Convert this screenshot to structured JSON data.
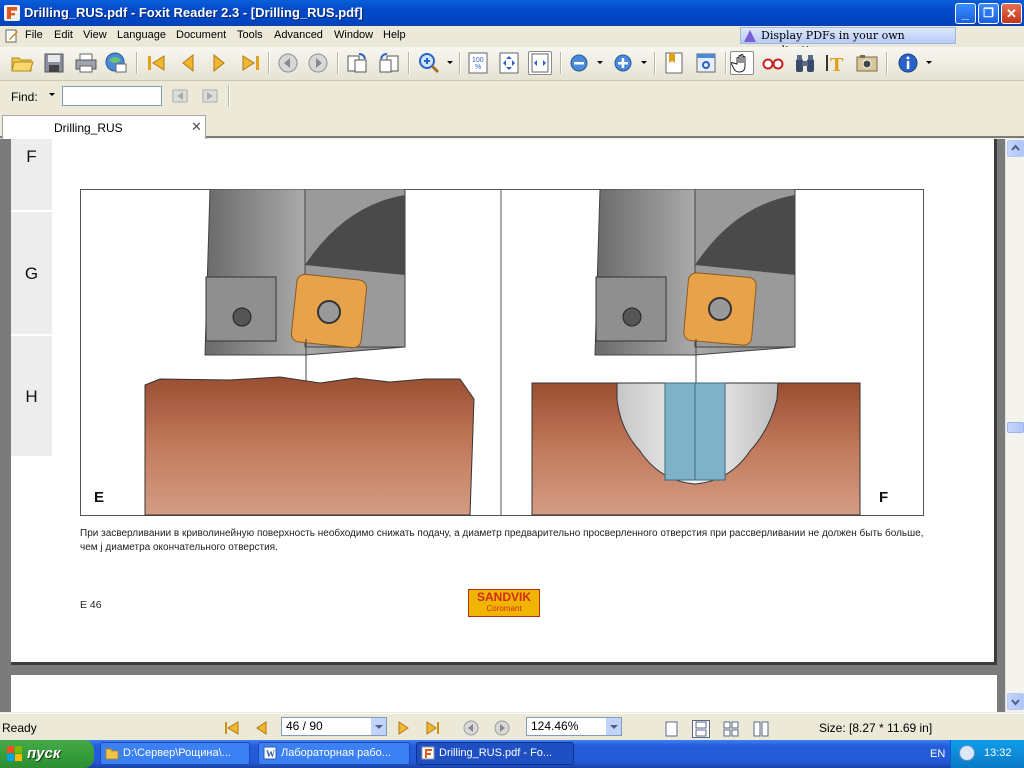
{
  "window": {
    "title": "Drilling_RUS.pdf - Foxit Reader 2.3 - [Drilling_RUS.pdf]",
    "controls": {
      "minimize": "_",
      "maximize": "❐",
      "close": "✕"
    }
  },
  "menu": {
    "items": [
      "File",
      "Edit",
      "View",
      "Language",
      "Document",
      "Tools",
      "Advanced",
      "Window",
      "Help"
    ],
    "promo": "Display PDFs in your own applications"
  },
  "toolbar": {
    "icons": [
      "open-icon",
      "save-icon",
      "print-icon",
      "email-icon",
      "first-page-icon",
      "prev-page-icon",
      "next-page-icon",
      "last-page-icon",
      "back-icon",
      "forward-icon",
      "rotate-left-icon",
      "rotate-right-icon",
      "zoom-in-icon",
      "actual-size-icon",
      "fit-page-icon",
      "fit-width-icon",
      "zoom-out-icon",
      "zoom-plus-icon",
      "bookmark-icon",
      "fullscreen-icon",
      "hand-icon",
      "glasses-icon",
      "binoculars-icon",
      "text-select-icon",
      "snapshot-icon",
      "info-icon"
    ]
  },
  "find": {
    "label": "Find:",
    "value": ""
  },
  "tabs": [
    {
      "label": "Drilling_RUS",
      "close": "✕"
    }
  ],
  "document": {
    "side_tabs": [
      "F",
      "G",
      "H"
    ],
    "figure_labels": {
      "left": "E",
      "right": "F"
    },
    "caption": "При засверливании в криволинейную поверхность необходимо снижать подачу, а диаметр предварительно просверленного отверстия при рассверливании не должен быть больше, чем j диаметра окончательного отверстия.",
    "page_label": "E 46",
    "logo": {
      "name": "SANDVIK",
      "sub": "Coromant"
    }
  },
  "status": {
    "text": "Ready",
    "page": "46 / 90",
    "zoom": "124.46%",
    "size": "Size: [8.27 * 11.69 in]"
  },
  "taskbar": {
    "start": "пуск",
    "tasks": [
      {
        "label": "D:\\Сервер\\Рощина\\..."
      },
      {
        "label": "Лабораторная рабо..."
      },
      {
        "label": "Drilling_RUS.pdf - Fo..."
      }
    ],
    "lang": "EN",
    "clock": "13:32"
  },
  "colors": {
    "titlebar": "#0248c8",
    "workpiece": "#b46a4c",
    "insert": "#e8a24a",
    "tool": "#8a8a8a",
    "sandvik_bg": "#f0b500",
    "sandvik_text": "#d22a1e"
  }
}
